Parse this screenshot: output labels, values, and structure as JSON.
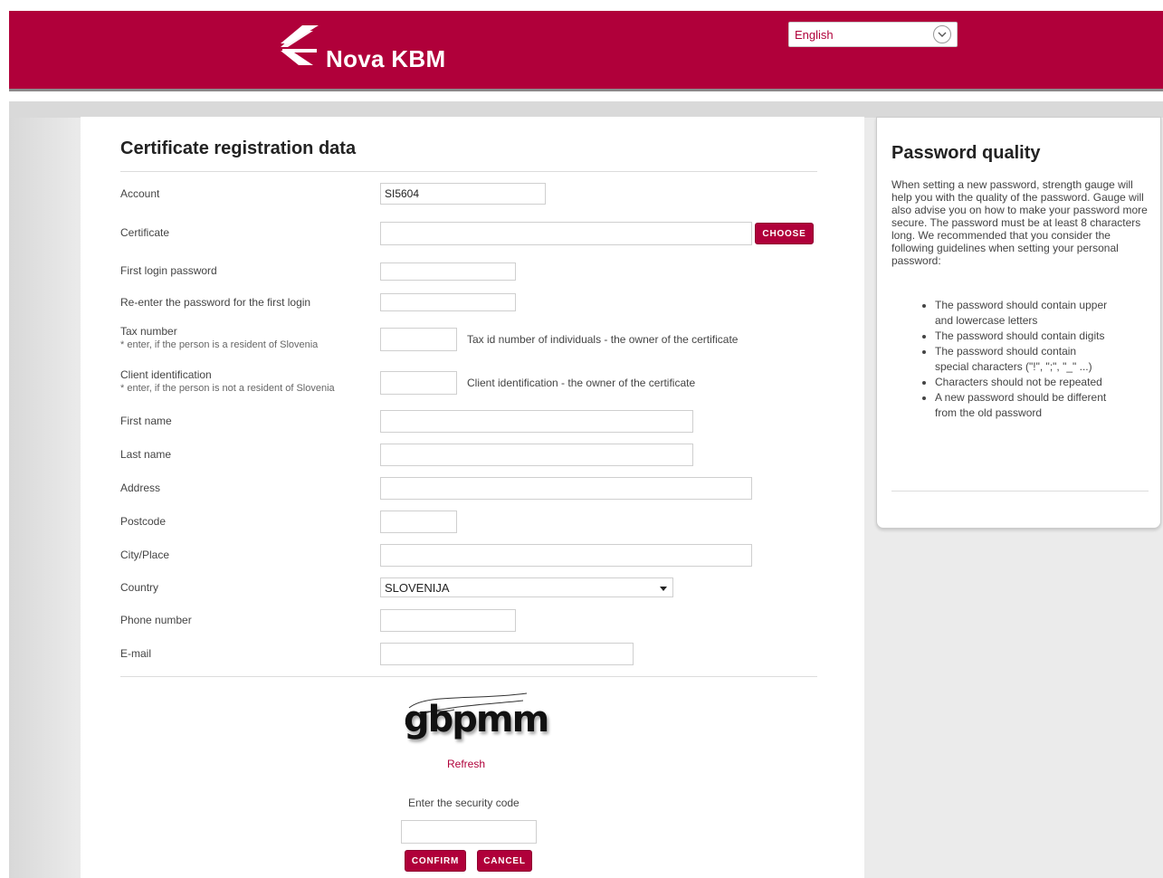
{
  "header": {
    "brand": "Nova KBM",
    "language": {
      "selected": "English"
    },
    "colors": {
      "brand": "#b0003a"
    }
  },
  "form": {
    "title": "Certificate registration data",
    "fields": {
      "account": {
        "label": "Account",
        "value": "SI5604"
      },
      "certificate": {
        "label": "Certificate",
        "value": "",
        "button": "CHOOSE"
      },
      "first_login_password": {
        "label": "First login password",
        "value": ""
      },
      "reenter_password": {
        "label": "Re-enter the password for the first login",
        "value": ""
      },
      "tax_number": {
        "label": "Tax number",
        "note": "* enter, if the person is a resident of Slovenia",
        "value": "",
        "hint": "Tax id number of individuals - the owner of the certificate"
      },
      "client_id": {
        "label": "Client identification",
        "note": "* enter, if the person is not a resident of Slovenia",
        "value": "",
        "hint": "Client identification - the owner of the certificate"
      },
      "first_name": {
        "label": "First name",
        "value": ""
      },
      "last_name": {
        "label": "Last name",
        "value": ""
      },
      "address": {
        "label": "Address",
        "value": ""
      },
      "postcode": {
        "label": "Postcode",
        "value": ""
      },
      "city": {
        "label": "City/Place",
        "value": ""
      },
      "country": {
        "label": "Country",
        "value": "SLOVENIJA"
      },
      "phone": {
        "label": "Phone number",
        "value": ""
      },
      "email": {
        "label": "E-mail",
        "value": ""
      }
    },
    "captcha": {
      "image_text": "gbpmm",
      "refresh": "Refresh",
      "label": "Enter the security code",
      "value": ""
    },
    "buttons": {
      "confirm": "CONFIRM",
      "cancel": "CANCEL"
    }
  },
  "sidebar": {
    "title": "Password quality",
    "intro": "When setting a new password, strength gauge will help you with the quality of the password. Gauge will also advise you on how to make your password more secure. The password must be at least 8 characters long. We recommended that you consider the following guidelines when setting your personal password:",
    "guidelines": [
      "The password should contain upper and lowercase letters",
      "The password should contain digits",
      "The password should contain special characters (\"!\", \";\", \"_\" ...)",
      "Characters should not be repeated",
      "A new password should be different from the old password"
    ]
  }
}
